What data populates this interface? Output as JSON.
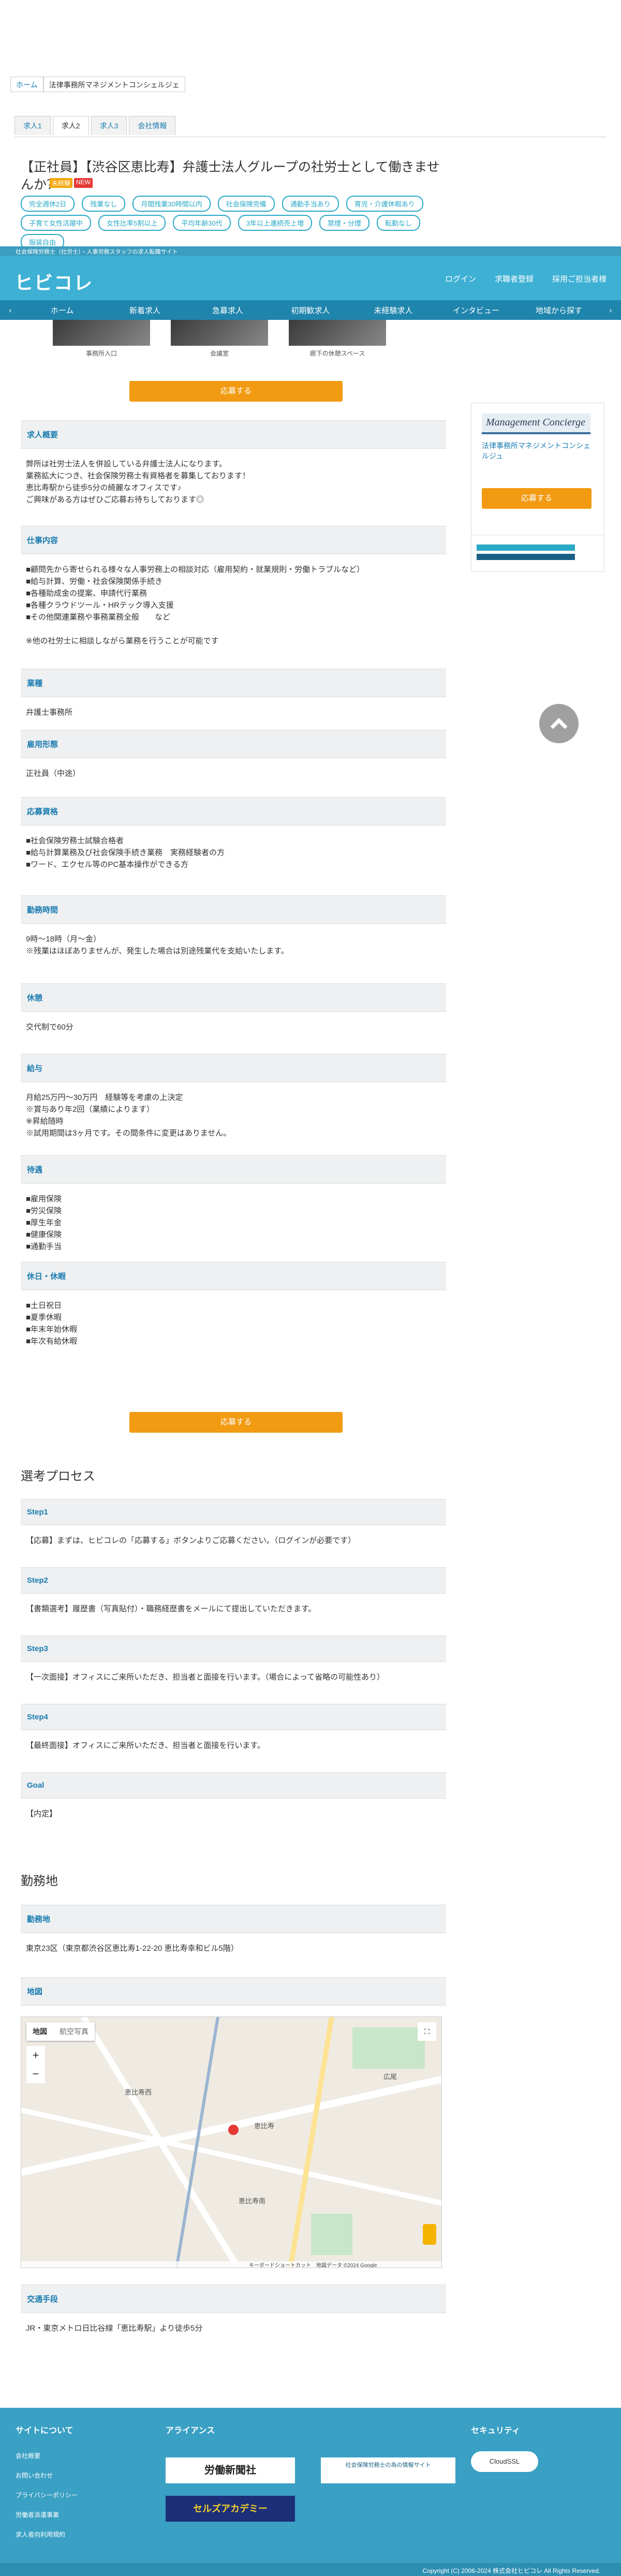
{
  "breadcrumb": [
    "ホーム",
    "法律事務所マネジメントコンシェルジェ"
  ],
  "tabs": [
    "求人1",
    "求人2",
    "求人3",
    "会社情報"
  ],
  "job": {
    "title": "【正社員】【渋谷区恵比寿】弁護士法人グループの社労士として働きませんか？",
    "badges": [
      "未経験",
      "NEW"
    ],
    "tags": [
      "完全週休2日",
      "残業なし",
      "月間残業30時間以内",
      "社会保険完備",
      "通勤手当あり",
      "育児・介護休暇あり",
      "子育て女性活躍中",
      "女性比率5割以上",
      "平均年齢30代",
      "3年以上連続売上増",
      "禁煙・分煙",
      "転勤なし",
      "服装自由"
    ]
  },
  "site": {
    "tagline": "社会保険労務士（社労士）・人事労務スタッフの求人転職サイト",
    "logo": "ヒビコレ",
    "header_links": [
      "ログイン",
      "求職者登録",
      "採用ご担当者様"
    ],
    "nav": [
      "ホーム",
      "新着求人",
      "急募求人",
      "初期歓求人",
      "未経験求人",
      "インタビュー",
      "地域から探す"
    ]
  },
  "photos": [
    "事務所入口",
    "会議室",
    "廊下の休憩スペース"
  ],
  "apply_label": "応募する",
  "sidebar": {
    "logo_text": "Management Concierge",
    "company": "法律事務所マネジメントコンシェルジュ",
    "button": "応募する"
  },
  "sections": [
    {
      "h": "求人概要",
      "b": "弊所は社労士法人を併設している弁護士法人になります。\n業務拡大につき、社会保険労務士有資格者を募集しております！\n恵比寿駅から徒歩5分の綺麗なオフィスです♪\nご興味がある方はぜひご応募お待ちしております◎"
    },
    {
      "h": "仕事内容",
      "b": "■顧問先から寄せられる様々な人事労務上の相談対応（雇用契約・就業規則・労働トラブルなど）\n■給与計算、労働・社会保険関係手続き\n■各種助成金の提案、申請代行業務\n■各種クラウドツール・HRテック導入支援\n■その他関連業務や事務業務全般　　など\n\n※他の社労士に相談しながら業務を行うことが可能です"
    },
    {
      "h": "業種",
      "b": "弁護士事務所"
    },
    {
      "h": "雇用形態",
      "b": "正社員（中途）"
    },
    {
      "h": "応募資格",
      "b": "■社会保険労務士試験合格者\n■給与計算業務及び社会保険手続き業務　実務経験者の方\n■ワード、エクセル等のPC基本操作ができる方"
    },
    {
      "h": "勤務時間",
      "b": "9時〜18時（月〜金）\n※残業はほぼありませんが、発生した場合は別途残業代を支給いたします。"
    },
    {
      "h": "休憩",
      "b": "交代制で60分"
    },
    {
      "h": "給与",
      "b": "月給25万円〜30万円　経験等を考慮の上決定\n※賞与あり年2回（業績によります）\n※昇給随時\n※試用期間は3ヶ月です。その間条件に変更はありません。"
    },
    {
      "h": "待遇",
      "b": "■雇用保険\n■労災保険\n■厚生年金\n■健康保険\n■通勤手当"
    },
    {
      "h": "休日・休暇",
      "b": "■土日祝日\n■夏季休暇\n■年末年始休暇\n■年次有給休暇"
    }
  ],
  "process": {
    "title": "選考プロセス",
    "steps": [
      {
        "h": "Step1",
        "b": "【応募】まずは、ヒビコレの「応募する」ボタンよりご応募ください。（ログインが必要です）"
      },
      {
        "h": "Step2",
        "b": "【書類選考】履歴書（写真貼付）・職務経歴書をメールにて提出していただきます。"
      },
      {
        "h": "Step3",
        "b": "【一次面接】オフィスにご来所いただき、担当者と面接を行います。（場合によって省略の可能性あり）"
      },
      {
        "h": "Step4",
        "b": "【最終面接】オフィスにご来所いただき、担当者と面接を行います。"
      },
      {
        "h": "Goal",
        "b": "【内定】"
      }
    ]
  },
  "location": {
    "title": "勤務地",
    "place_h": "勤務地",
    "place_b": "東京23区（東京都渋谷区恵比寿1-22-20 恵比寿幸和ビル5階）",
    "map_h": "地図",
    "map_tabs": [
      "地図",
      "航空写真"
    ],
    "map_labels": [
      "恵比寿",
      "恵比寿南",
      "恵比寿西",
      "広尾"
    ],
    "map_footer": "キーボードショートカット　地図データ ©2024 Google",
    "access_h": "交通手段",
    "access_b": "JR・東京メトロ日比谷線「恵比寿駅」より徒歩5分"
  },
  "footer": {
    "about": "サイトについて",
    "about_links": [
      "会社概要",
      "お問い合わせ",
      "プライバシーポリシー",
      "労働者派遣事業",
      "求人者向利用規約"
    ],
    "alliance": "アライアンス",
    "alliance_logos": [
      "労働新聞社",
      "社会保険労務士の為の情報サイト",
      "セルズアカデミー"
    ],
    "security": "セキュリティ",
    "security_badge": "CloudSSL",
    "copyright": "Copyright (C) 2006-2024 株式会社ヒビコレ All Rights Reserved."
  }
}
